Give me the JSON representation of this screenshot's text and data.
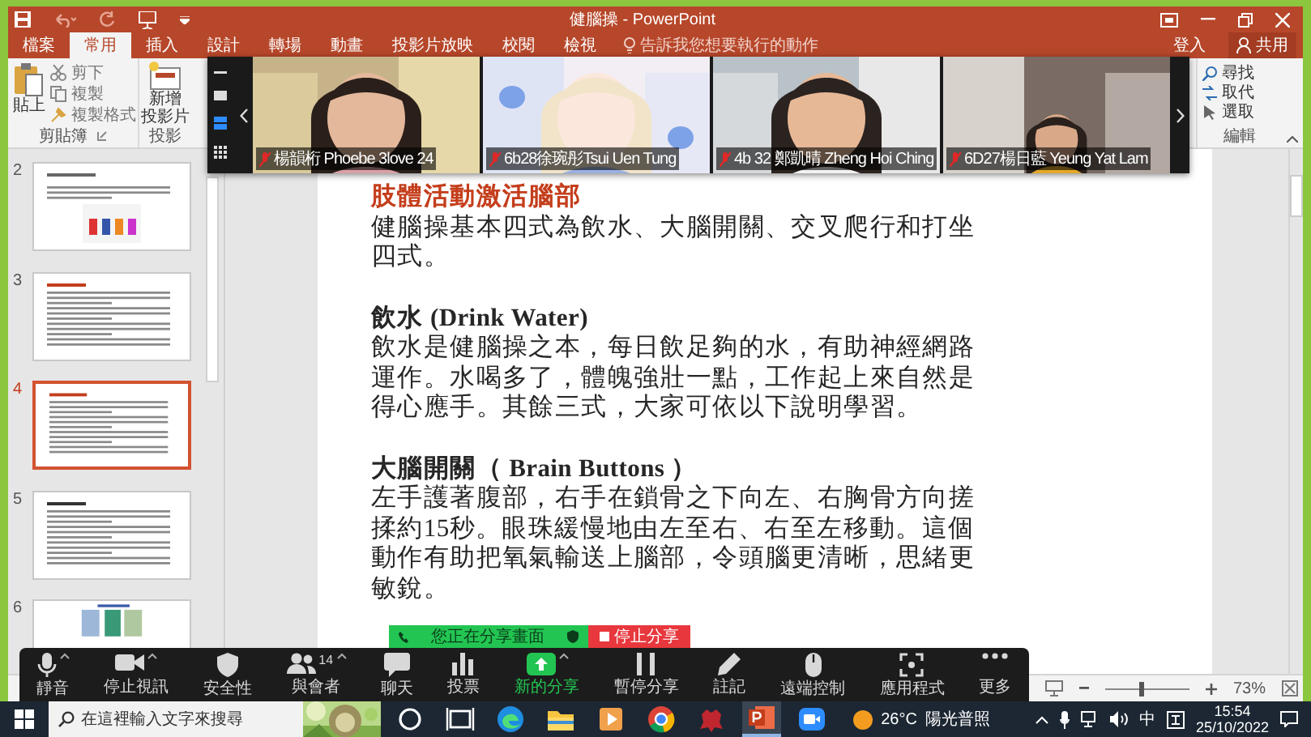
{
  "title_bar": {
    "title": "健腦操 - PowerPoint"
  },
  "ribbon_tabs": [
    {
      "label": "檔案",
      "selected": false
    },
    {
      "label": "常用",
      "selected": true
    },
    {
      "label": "插入",
      "selected": false
    },
    {
      "label": "設計",
      "selected": false
    },
    {
      "label": "轉場",
      "selected": false
    },
    {
      "label": "動畫",
      "selected": false
    },
    {
      "label": "投影片放映",
      "selected": false
    },
    {
      "label": "校閱",
      "selected": false
    },
    {
      "label": "檢視",
      "selected": false
    }
  ],
  "tell_me": {
    "placeholder": "告訴我您想要執行的動作"
  },
  "account": {
    "sign_in": "登入",
    "share": "共用"
  },
  "ribbon": {
    "paste": "貼上",
    "clipboard_items": [
      "剪下",
      "複製",
      "複製格式"
    ],
    "clipboard_group": "剪貼簿",
    "new_slide": [
      "新增",
      "投影片"
    ],
    "slides_group": "投影",
    "editing_items": [
      "尋找",
      "取代",
      "選取"
    ],
    "editing_group": "編輯"
  },
  "video_strip": {
    "participants": [
      {
        "name": "楊韻桁 Phoebe 3love 24",
        "muted": true
      },
      {
        "name": "6b28徐琬彤Tsui Uen Tung",
        "muted": true
      },
      {
        "name": "4b 32 鄭凱晴 Zheng Hoi Ching",
        "muted": true
      },
      {
        "name": "6D27楊日藍 Yeung Yat Lam",
        "muted": true
      }
    ]
  },
  "slide_thumbnails": [
    {
      "number": "2",
      "selected": false
    },
    {
      "number": "3",
      "selected": false
    },
    {
      "number": "4",
      "selected": true
    },
    {
      "number": "5",
      "selected": false
    },
    {
      "number": "6",
      "selected": false
    }
  ],
  "slide": {
    "heading": "肢體活動激活腦部",
    "paragraphs": [
      {
        "kind": "body",
        "text": "健腦操基本四式為飲水、大腦開關、交叉爬行和打坐四式。"
      },
      {
        "kind": "title",
        "text": "飲水 (Drink Water)"
      },
      {
        "kind": "body",
        "text": "飲水是健腦操之本，每日飲足夠的水，有助神經網路運作。水喝多了，體魄強壯一點，工作起上來自然是得心應手。其餘三式，大家可依以下說明學習。"
      },
      {
        "kind": "title",
        "text": "大腦開關（ Brain Buttons ）"
      },
      {
        "kind": "body",
        "text": "左手護著腹部，右手在鎖骨之下向左、右胸骨方向搓揉約15秒。眼珠緩慢地由左至右、右至左移動。這個動作有助把氧氣輸送上腦部，令頭腦更清晰，思緒更敏銳。"
      }
    ]
  },
  "share_banner": {
    "status": "您正在分享畫面",
    "stop": "停止分享"
  },
  "meeting_toolbar": [
    {
      "kind": "mic",
      "label": "靜音",
      "menu": true,
      "highlighted": false
    },
    {
      "kind": "camera",
      "label": "停止視訊",
      "menu": true,
      "highlighted": false
    },
    {
      "kind": "shield",
      "label": "安全性",
      "menu": false,
      "highlighted": false
    },
    {
      "kind": "people",
      "label": "與會者",
      "count": "14",
      "menu": true,
      "highlighted": false
    },
    {
      "kind": "chat",
      "label": "聊天",
      "menu": false,
      "highlighted": false
    },
    {
      "kind": "poll",
      "label": "投票",
      "menu": false,
      "highlighted": false
    },
    {
      "kind": "share",
      "label": "新的分享",
      "menu": true,
      "highlighted": true
    },
    {
      "kind": "pause",
      "label": "暫停分享",
      "menu": false,
      "highlighted": false
    },
    {
      "kind": "pen",
      "label": "註記",
      "menu": false,
      "highlighted": false
    },
    {
      "kind": "mouse",
      "label": "遠端控制",
      "menu": false,
      "highlighted": false
    },
    {
      "kind": "apps",
      "label": "應用程式",
      "menu": false,
      "highlighted": false
    },
    {
      "kind": "more",
      "label": "更多",
      "menu": false,
      "highlighted": false
    }
  ],
  "status_bar": {
    "zoom": "73%",
    "level": 0.4
  },
  "taskbar": {
    "search": {
      "placeholder": "在這裡輸入文字來搜尋"
    },
    "apps": [
      {
        "kind": "cortana",
        "active": false
      },
      {
        "kind": "taskview",
        "active": false
      },
      {
        "kind": "edge",
        "active": false
      },
      {
        "kind": "explorer",
        "active": false
      },
      {
        "kind": "media",
        "active": false
      },
      {
        "kind": "chrome",
        "active": false
      },
      {
        "kind": "game",
        "active": false
      },
      {
        "kind": "powerpoint",
        "active": true
      },
      {
        "kind": "zoom",
        "active": false
      }
    ],
    "weather": {
      "temperature": "26°C",
      "condition": "陽光普照"
    },
    "ime": "中",
    "time": "15:54",
    "date": "25/10/2022"
  }
}
